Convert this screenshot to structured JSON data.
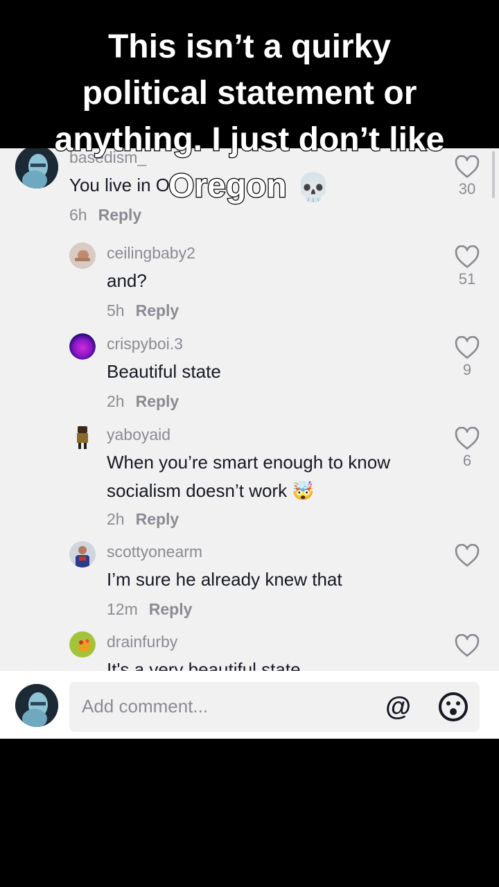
{
  "caption": {
    "line1": "This isn’t a quirky",
    "line2": "political statement or",
    "line3": "anything. I just don’t like",
    "line4": "Oregon",
    "emoji": "💀"
  },
  "comments": [
    {
      "username": "basedism_",
      "text": "You live in Or",
      "time": "6h",
      "reply": "Reply",
      "likes": "30",
      "avatar": "blue-figure-avatar"
    },
    {
      "username": "ceilingbaby2",
      "text": "and?",
      "time": "5h",
      "reply": "Reply",
      "likes": "51",
      "avatar": "baby-avatar"
    },
    {
      "username": "crispyboi.3",
      "text": "Beautiful state",
      "time": "2h",
      "reply": "Reply",
      "likes": "9",
      "avatar": "purple-avatar"
    },
    {
      "username": "yaboyaid",
      "text1": "When you’re smart enough to know",
      "text2": "socialism doesn’t work",
      "emoji": "🤯",
      "time": "2h",
      "reply": "Reply",
      "likes": "6",
      "avatar": "figure-avatar"
    },
    {
      "username": "scottyonearm",
      "text": "I’m sure he already knew that",
      "time": "12m",
      "reply": "Reply",
      "likes": "",
      "avatar": "person-avatar"
    },
    {
      "username": "drainfurby",
      "text": "It's a very beautiful state",
      "avatar": "furby-avatar"
    }
  ],
  "add_comment": {
    "placeholder": "Add comment...",
    "at_symbol": "@"
  },
  "colors": {
    "panel_bg": "#f1f1f2",
    "text_primary": "#161823",
    "text_secondary": "#8a8b91"
  }
}
